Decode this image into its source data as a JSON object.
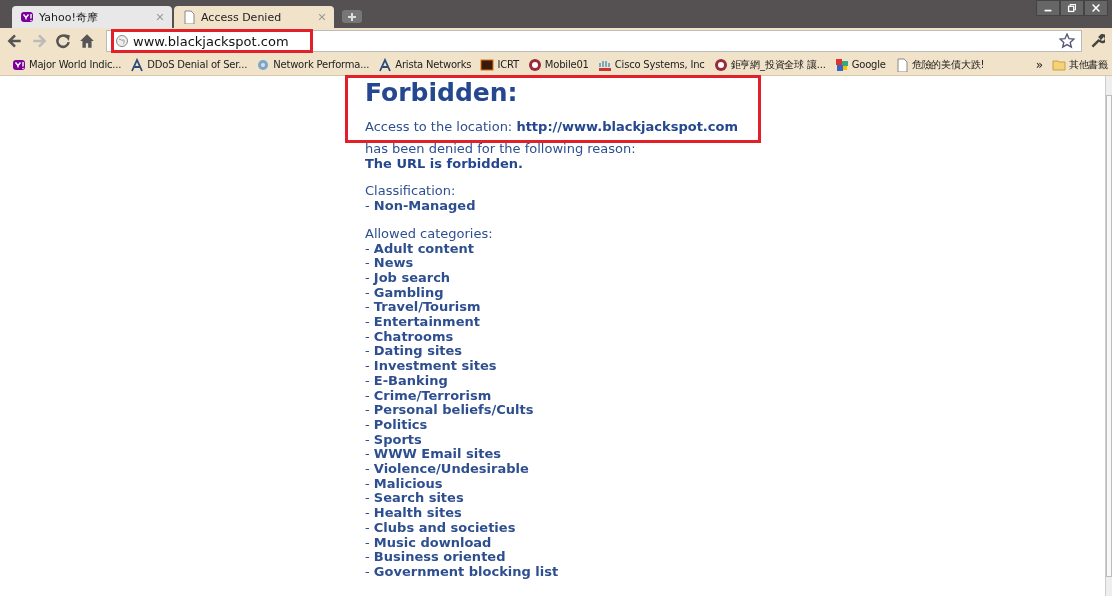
{
  "tabs": [
    {
      "title": "Yahoo!奇摩",
      "selected": false
    },
    {
      "title": "Access Denied",
      "selected": true
    }
  ],
  "address_bar": {
    "value": "www.blackjackspot.com",
    "annotated": true
  },
  "bookmarks": [
    {
      "label": "Major World Indic..."
    },
    {
      "label": "DDoS Denial of Ser..."
    },
    {
      "label": "Network Performa..."
    },
    {
      "label": "Arista Networks"
    },
    {
      "label": "ICRT"
    },
    {
      "label": "Mobile01"
    },
    {
      "label": "Cisco Systems, Inc"
    },
    {
      "label": "鉅亨網_投資全球 讓..."
    },
    {
      "label": "Google"
    },
    {
      "label": "危險的美債大跌!"
    }
  ],
  "overflow": "»",
  "other_bookmarks": "其他書籤",
  "notice": {
    "title": "Forbidden:",
    "access_line": "Access to the location: **http://www.blackjackspot.com**",
    "annotated": true
  },
  "reason_intro": "has been denied for the following reason:",
  "reason": "The URL is forbidden.",
  "classification_label": "Classification:",
  "classification": "- **Non-Managed**",
  "categories_label": "Allowed categories:",
  "categories": [
    "- **Adult content**",
    "- **News**",
    "- **Job search**",
    "- **Gambling**",
    "- **Travel/Tourism**",
    "- **Entertainment**",
    "- **Chatrooms**",
    "- **Dating sites**",
    "- **Investment sites**",
    "- **E-Banking**",
    "- **Crime/Terrorism**",
    "- **Personal beliefs/Cults**",
    "- **Politics**",
    "- **Sports**",
    "- **WWW Email sites**",
    "- **Violence/Undesirable**",
    "- **Malicious**",
    "- **Search sites**",
    "- **Health sites**",
    "- **Clubs and societies**",
    "- **Music download**",
    "- **Business oriented**",
    "- **Government blocking list**"
  ]
}
